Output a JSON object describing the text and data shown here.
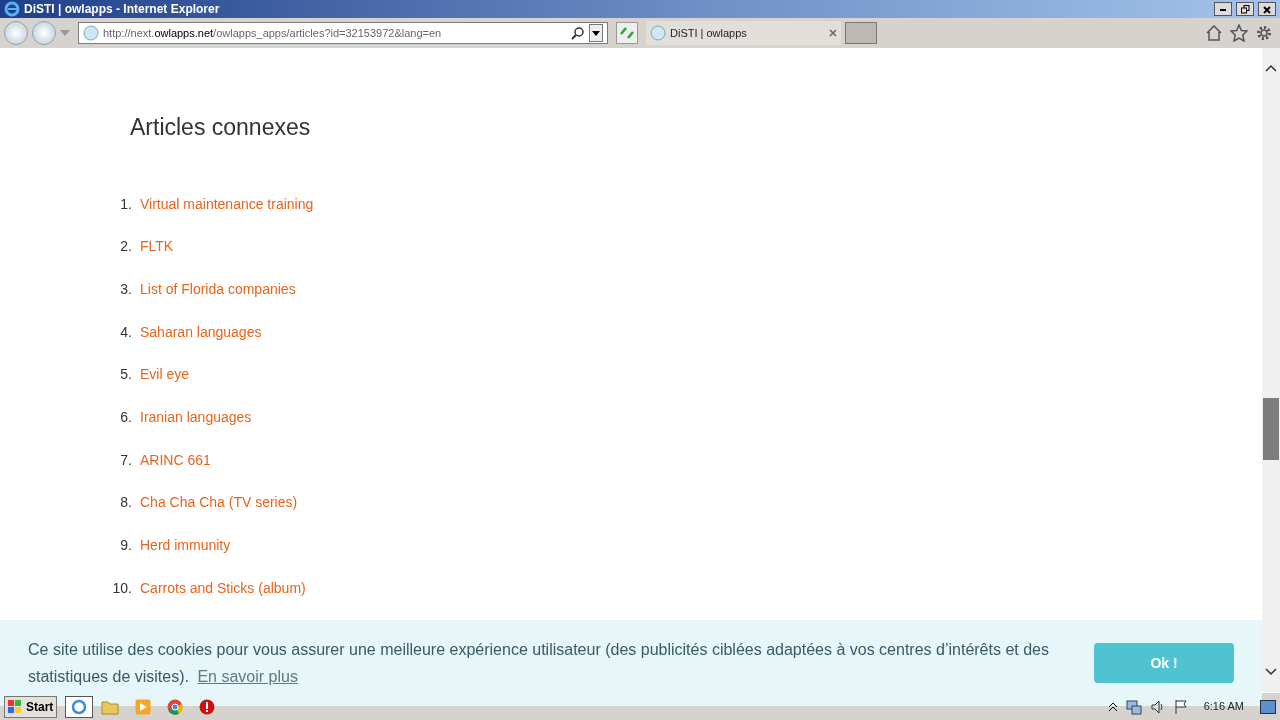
{
  "window": {
    "title": "DiSTI | owlapps - Internet Explorer"
  },
  "address_bar": {
    "url_prefix": "http://next.",
    "url_domain": "owlapps.net",
    "url_path": "/owlapps_apps/articles?id=32153972&lang=en"
  },
  "tabs": [
    {
      "label": "DiSTI | owlapps",
      "selected": true
    }
  ],
  "page": {
    "heading": "Articles connexes",
    "articles": [
      {
        "number": "1.",
        "title": "Virtual maintenance training"
      },
      {
        "number": "2.",
        "title": "FLTK"
      },
      {
        "number": "3.",
        "title": "List of Florida companies"
      },
      {
        "number": "4.",
        "title": "Saharan languages"
      },
      {
        "number": "5.",
        "title": "Evil eye"
      },
      {
        "number": "6.",
        "title": "Iranian languages"
      },
      {
        "number": "7.",
        "title": "ARINC 661"
      },
      {
        "number": "8.",
        "title": "Cha Cha Cha (TV series)"
      },
      {
        "number": "9.",
        "title": "Herd immunity"
      },
      {
        "number": "10.",
        "title": "Carrots and Sticks (album)"
      }
    ]
  },
  "cookie_banner": {
    "message": "Ce site utilise des cookies pour vous assurer une meilleure expérience utilisateur (des publicités ciblées adaptées à vos centres d’intérêts et des statistiques de visites).",
    "link": "En savoir plus",
    "button": "Ok !"
  },
  "taskbar": {
    "start": "Start",
    "clock": "6:16 AM"
  }
}
